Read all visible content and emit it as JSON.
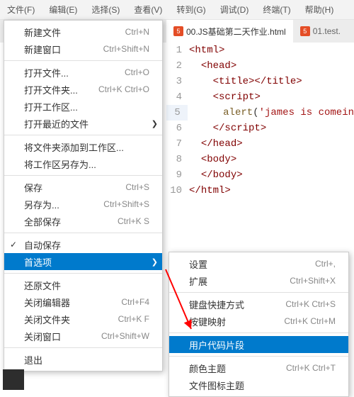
{
  "menubar": {
    "items": [
      {
        "label": "文件(F)"
      },
      {
        "label": "编辑(E)"
      },
      {
        "label": "选择(S)"
      },
      {
        "label": "查看(V)"
      },
      {
        "label": "转到(G)"
      },
      {
        "label": "调试(D)"
      },
      {
        "label": "终端(T)"
      },
      {
        "label": "帮助(H)"
      }
    ]
  },
  "tabs": [
    {
      "label": "00.JS基础第二天作业.html",
      "active": true
    },
    {
      "label": "01.test."
    }
  ],
  "file_menu": {
    "groups": [
      [
        {
          "label": "新建文件",
          "kbd": "Ctrl+N"
        },
        {
          "label": "新建窗口",
          "kbd": "Ctrl+Shift+N"
        }
      ],
      [
        {
          "label": "打开文件...",
          "kbd": "Ctrl+O"
        },
        {
          "label": "打开文件夹...",
          "kbd": "Ctrl+K Ctrl+O"
        },
        {
          "label": "打开工作区..."
        },
        {
          "label": "打开最近的文件",
          "sub": true
        }
      ],
      [
        {
          "label": "将文件夹添加到工作区..."
        },
        {
          "label": "将工作区另存为..."
        }
      ],
      [
        {
          "label": "保存",
          "kbd": "Ctrl+S"
        },
        {
          "label": "另存为...",
          "kbd": "Ctrl+Shift+S"
        },
        {
          "label": "全部保存",
          "kbd": "Ctrl+K S"
        }
      ],
      [
        {
          "label": "自动保存",
          "check": true
        },
        {
          "label": "首选项",
          "sub": true,
          "hl": true
        }
      ],
      [
        {
          "label": "还原文件"
        },
        {
          "label": "关闭编辑器",
          "kbd": "Ctrl+F4"
        },
        {
          "label": "关闭文件夹",
          "kbd": "Ctrl+K F"
        },
        {
          "label": "关闭窗口",
          "kbd": "Ctrl+Shift+W"
        }
      ],
      [
        {
          "label": "退出"
        }
      ]
    ]
  },
  "pref_submenu": {
    "groups": [
      [
        {
          "label": "设置",
          "kbd": "Ctrl+,"
        },
        {
          "label": "扩展",
          "kbd": "Ctrl+Shift+X"
        }
      ],
      [
        {
          "label": "键盘快捷方式",
          "kbd": "Ctrl+K Ctrl+S"
        },
        {
          "label": "按键映射",
          "kbd": "Ctrl+K Ctrl+M"
        }
      ],
      [
        {
          "label": "用户代码片段",
          "hl": true
        }
      ],
      [
        {
          "label": "颜色主题",
          "kbd": "Ctrl+K Ctrl+T"
        },
        {
          "label": "文件图标主题"
        }
      ]
    ]
  },
  "code": {
    "lines": [
      {
        "n": "1",
        "html": "<span class='t-punc'>&lt;</span><span class='t-tag'>html</span><span class='t-punc'>&gt;</span>"
      },
      {
        "n": "2",
        "html": "  <span class='t-punc'>&lt;</span><span class='t-tag'>head</span><span class='t-punc'>&gt;</span>"
      },
      {
        "n": "3",
        "html": "    <span class='t-punc'>&lt;</span><span class='t-tag'>title</span><span class='t-punc'>&gt;&lt;/</span><span class='t-tag'>title</span><span class='t-punc'>&gt;</span>"
      },
      {
        "n": "4",
        "html": "    <span class='t-punc'>&lt;</span><span class='t-tag'>script</span><span class='t-punc'>&gt;</span>"
      },
      {
        "n": "5",
        "html": "      <span class='t-id'>alert</span>(<span class='t-str'>'james is comein</span>"
      },
      {
        "n": "6",
        "html": "    <span class='t-punc'>&lt;/</span><span class='t-tag'>script</span><span class='t-punc'>&gt;</span>"
      },
      {
        "n": "7",
        "html": "  <span class='t-punc'>&lt;/</span><span class='t-tag'>head</span><span class='t-punc'>&gt;</span>"
      },
      {
        "n": "8",
        "html": "  <span class='t-punc'>&lt;</span><span class='t-tag'>body</span><span class='t-punc'>&gt;</span>"
      },
      {
        "n": "9",
        "html": "  <span class='t-punc'>&lt;/</span><span class='t-tag'>body</span><span class='t-punc'>&gt;</span>"
      },
      {
        "n": "10",
        "html": "<span class='t-punc'>&lt;/</span><span class='t-tag'>html</span><span class='t-punc'>&gt;</span>"
      }
    ]
  },
  "icon_glyph": "5"
}
